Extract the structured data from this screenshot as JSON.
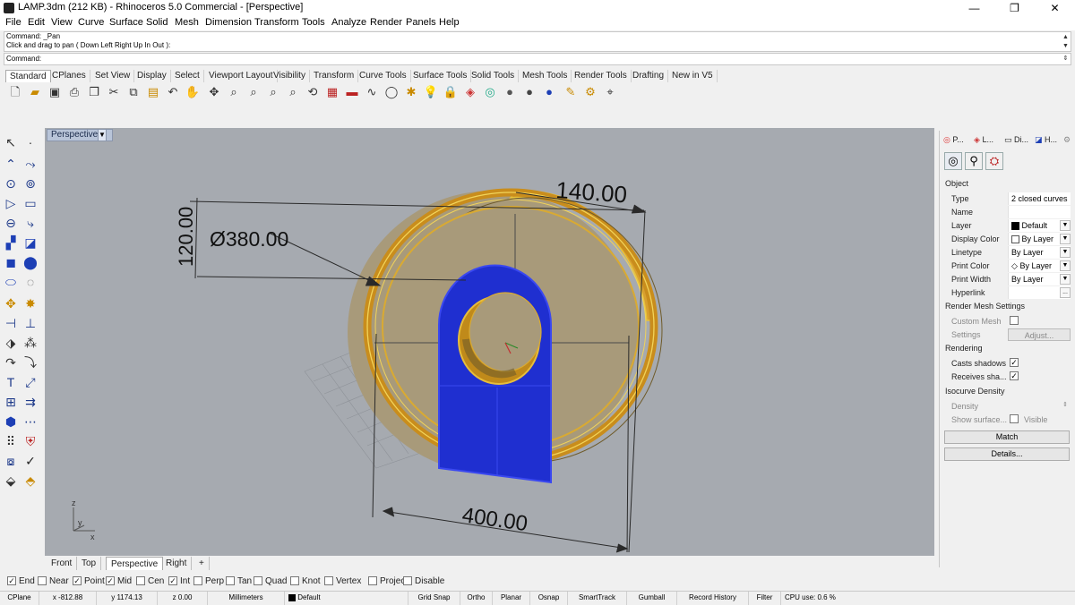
{
  "window": {
    "title": "LAMP.3dm (212 KB) - Rhinoceros 5.0 Commercial - [Perspective]",
    "minimize": "—",
    "maximize": "❐",
    "close": "✕"
  },
  "menu": [
    "File",
    "Edit",
    "View",
    "Curve",
    "Surface",
    "Solid",
    "Mesh",
    "Dimension",
    "Transform",
    "Tools",
    "Analyze",
    "Render",
    "Panels",
    "Help"
  ],
  "command": {
    "history": [
      "Command: _Pan",
      "Click and drag to pan ( Down  Left  Right  Up  In  Out ):"
    ],
    "prompt": "Command:"
  },
  "toolbar_tabs": [
    "Standard",
    "CPlanes",
    "Set View",
    "Display",
    "Select",
    "Viewport Layout",
    "Visibility",
    "Transform",
    "Curve Tools",
    "Surface Tools",
    "Solid Tools",
    "Mesh Tools",
    "Render Tools",
    "Drafting",
    "New in V5"
  ],
  "toolbar_icons": [
    "new-icon",
    "open-icon",
    "save-icon",
    "print-icon",
    "template-icon",
    "cut-icon",
    "copy-icon",
    "paste-icon",
    "undo-icon",
    "pan-icon",
    "rotate-icon",
    "zoom-window-icon",
    "zoom-dynamic-icon",
    "zoom-extents-icon",
    "zoom-selected-icon",
    "rotate-view-icon",
    "grid-icon",
    "car-icon",
    "curve-icon",
    "circle-icon",
    "point-icon",
    "light-icon",
    "lock-icon",
    "render-icon",
    "color-wheel-icon",
    "sphere-icon",
    "shade-icon",
    "globe-icon",
    "brush-icon",
    "settings-icon",
    "help-icon"
  ],
  "viewport": {
    "label": "Perspective",
    "dims": {
      "width": "140.00",
      "height": "120.00",
      "diameter": "Ø380.00",
      "length": "400.00"
    },
    "axis_z": "z",
    "axis_y": "y",
    "axis_x": "x"
  },
  "viewport_tabs": [
    "Front",
    "Top",
    "Perspective",
    "Right"
  ],
  "viewport_tabs_add": "+",
  "panel": {
    "tabs": [
      "P...",
      "L...",
      "Di...",
      "H..."
    ],
    "object_heading": "Object",
    "rows": [
      {
        "label": "Type",
        "value": "2 closed curves"
      },
      {
        "label": "Name",
        "value": ""
      },
      {
        "label": "Layer",
        "value": "Default"
      },
      {
        "label": "Display Color",
        "value": "By Layer"
      },
      {
        "label": "Linetype",
        "value": "By Layer"
      },
      {
        "label": "Print Color",
        "value": "By Layer"
      },
      {
        "label": "Print Width",
        "value": "By Layer"
      },
      {
        "label": "Hyperlink",
        "value": ""
      }
    ],
    "hyperlink_button": "...",
    "render_mesh_heading": "Render Mesh Settings",
    "custom_mesh": "Custom Mesh",
    "settings": "Settings",
    "adjust": "Adjust...",
    "rendering_heading": "Rendering",
    "casts_shadows": "Casts shadows",
    "receives_shadows": "Receives sha...",
    "isocurve_heading": "Isocurve Density",
    "density": "Density",
    "show_surface": "Show surface...",
    "visible": "Visible",
    "match": "Match",
    "details": "Details..."
  },
  "osnaps": [
    {
      "label": "End",
      "checked": true
    },
    {
      "label": "Near",
      "checked": false
    },
    {
      "label": "Point",
      "checked": true
    },
    {
      "label": "Mid",
      "checked": true
    },
    {
      "label": "Cen",
      "checked": false
    },
    {
      "label": "Int",
      "checked": true
    },
    {
      "label": "Perp",
      "checked": false
    },
    {
      "label": "Tan",
      "checked": false
    },
    {
      "label": "Quad",
      "checked": false
    },
    {
      "label": "Knot",
      "checked": false
    },
    {
      "label": "Vertex",
      "checked": false
    },
    {
      "label": "Project",
      "checked": false
    },
    {
      "label": "Disable",
      "checked": false
    }
  ],
  "status": {
    "cplane": "CPlane",
    "x": "x -812.88",
    "y": "y 1174.13",
    "z": "z 0.00",
    "units": "Millimeters",
    "layer": "Default",
    "grid_snap": "Grid Snap",
    "ortho": "Ortho",
    "planar": "Planar",
    "osnap": "Osnap",
    "smarttrack": "SmartTrack",
    "gumball": "Gumball",
    "record_history": "Record History",
    "filter": "Filter",
    "cpu": "CPU use: 0.6 %"
  },
  "colors": {
    "ring": "#e0a62a",
    "plate": "#1f2fd0",
    "viewport_bg": "#a6aab0"
  }
}
